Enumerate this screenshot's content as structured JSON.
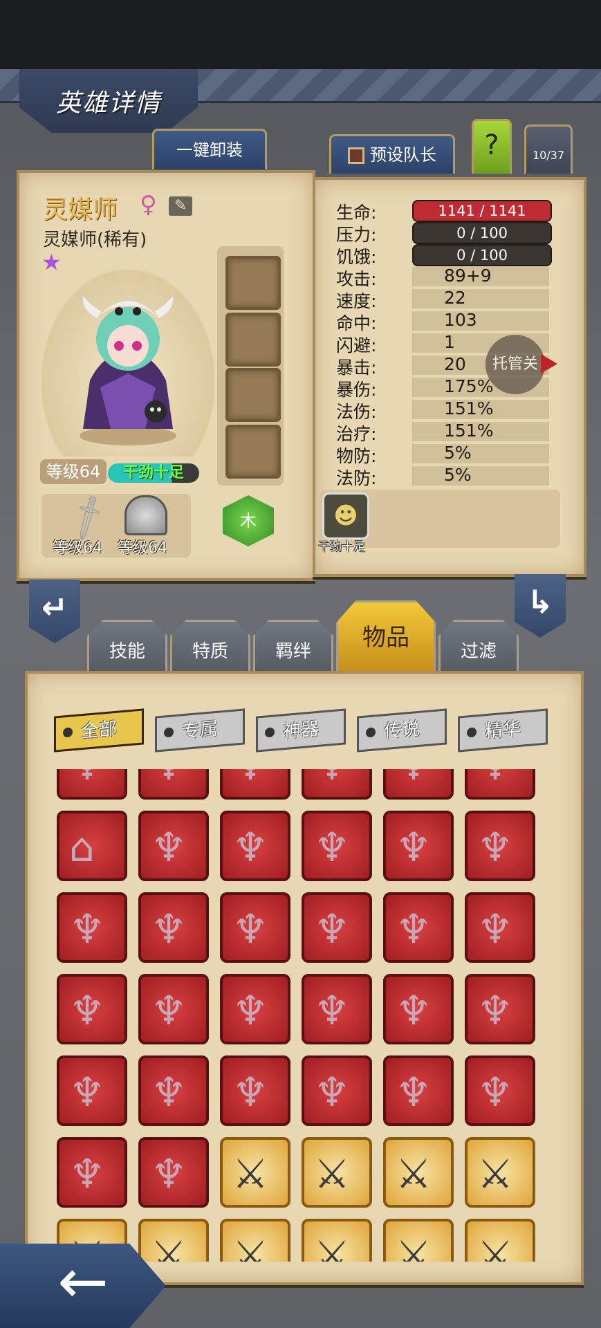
{
  "header": {
    "title": "英雄详情"
  },
  "top_buttons": {
    "unequip_all": "一键卸装",
    "preset_captain": "预设队长",
    "help": "?",
    "page_counter": "10/37"
  },
  "hero": {
    "name": "灵媒师",
    "gender_symbol": "♀",
    "subtitle": "灵媒师(稀有)",
    "rarity_star": "★",
    "level": "等级64",
    "mood": "干劲十足",
    "weapon_level": "等级64",
    "armor_level": "等级64",
    "element": "木"
  },
  "stats": [
    {
      "label": "生命:",
      "value": "1141 / 1141",
      "kind": "hp"
    },
    {
      "label": "压力:",
      "value": "0 / 100",
      "kind": "bar"
    },
    {
      "label": "饥饿:",
      "value": "0 / 100",
      "kind": "bar"
    },
    {
      "label": "攻击:",
      "value": "89+9"
    },
    {
      "label": "速度:",
      "value": "22"
    },
    {
      "label": "命中:",
      "value": "103"
    },
    {
      "label": "闪避:",
      "value": "1"
    },
    {
      "label": "暴击:",
      "value": "20"
    },
    {
      "label": "暴伤:",
      "value": "175%"
    },
    {
      "label": "法伤:",
      "value": "151%"
    },
    {
      "label": "治疗:",
      "value": "151%"
    },
    {
      "label": "物防:",
      "value": "5%"
    },
    {
      "label": "法防:",
      "value": "5%"
    }
  ],
  "overlay": {
    "auto_label": "托管关"
  },
  "trait": {
    "label": "干劲十足",
    "icon": "smile-bulb-icon"
  },
  "category_tabs": [
    "技能",
    "特质",
    "羁绊",
    "物品",
    "过滤"
  ],
  "active_category": "物品",
  "filters": [
    "全部",
    "专属",
    "神器",
    "传说",
    "精华"
  ],
  "active_filter": "全部",
  "inventory": {
    "rows": [
      [
        "red",
        "red",
        "red",
        "red",
        "red",
        "red"
      ],
      [
        "red-cloak",
        "red",
        "red",
        "red",
        "red",
        "red"
      ],
      [
        "red",
        "red",
        "red",
        "red",
        "red",
        "red"
      ],
      [
        "red",
        "red",
        "red",
        "red",
        "red",
        "red"
      ],
      [
        "red",
        "red",
        "red",
        "red",
        "red",
        "red"
      ],
      [
        "red",
        "red",
        "gold",
        "gold",
        "gold",
        "gold"
      ],
      [
        "gold",
        "gold",
        "gold",
        "gold",
        "gold",
        "gold"
      ]
    ]
  },
  "colors": {
    "parchment": "#e7d7b3",
    "hp_bar": "#c02a32",
    "active_tab": "#f3c83a",
    "item_red": "#b02226",
    "item_gold": "#e0a53a"
  }
}
